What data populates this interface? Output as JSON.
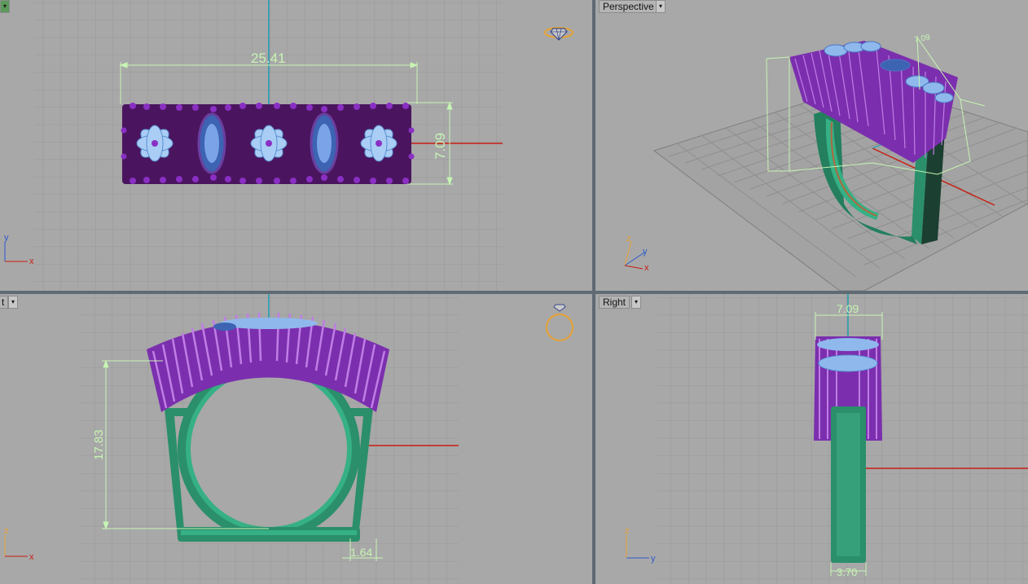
{
  "viewports": {
    "top": {
      "label": ""
    },
    "perspective": {
      "label": "Perspective"
    },
    "front": {
      "label": "t"
    },
    "right": {
      "label": "Right"
    }
  },
  "dimensions": {
    "top_width": "25.41",
    "top_height": "7.09",
    "perspective_height": "7.09",
    "front_height": "17.83",
    "front_width": "1.64",
    "right_width": "7.09",
    "right_bottom": "3.70"
  },
  "axes": {
    "x": "x",
    "y": "y",
    "z": "z"
  },
  "icons": {
    "gem_gizmo": "diamond-icon",
    "ring_gizmo": "ring-icon",
    "dropdown": "chevron-down-icon"
  },
  "colors": {
    "viewport_bg": "#a8a8a8",
    "grid": "#9a9a9a",
    "grid_major": "#8a8a8a",
    "prong_purple": "#7b2fae",
    "gem_blue": "#8fb9ec",
    "band_green": "#2a8f6a",
    "dim_line": "#c7f5b3",
    "axis_red": "#c81e12",
    "axis_cyan": "#1e9cb3",
    "gizmo_orange": "#e8a334"
  }
}
